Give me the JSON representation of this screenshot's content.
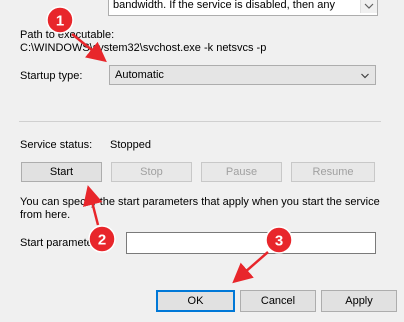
{
  "description": {
    "text": "bandwidth. If the service is disabled, then any"
  },
  "path": {
    "label": "Path to executable:",
    "value": "C:\\WINDOWS\\system32\\svchost.exe -k netsvcs -p"
  },
  "startup": {
    "label": "Startup type:",
    "value": "Automatic"
  },
  "status": {
    "label": "Service status:",
    "value": "Stopped"
  },
  "controls": {
    "start": "Start",
    "stop": "Stop",
    "pause": "Pause",
    "resume": "Resume"
  },
  "params": {
    "hint_line1": "You can specify the start parameters that apply when you start the service",
    "hint_line2": "from here.",
    "label": "Start parameters:",
    "value": ""
  },
  "dialog": {
    "ok": "OK",
    "cancel": "Cancel",
    "apply": "Apply"
  },
  "annotations": {
    "badge1": "1",
    "badge2": "2",
    "badge3": "3",
    "color": "#e8262b"
  },
  "icons": {
    "dropdown": "chevron-down-icon",
    "scroll": "scroll-down-icon"
  }
}
